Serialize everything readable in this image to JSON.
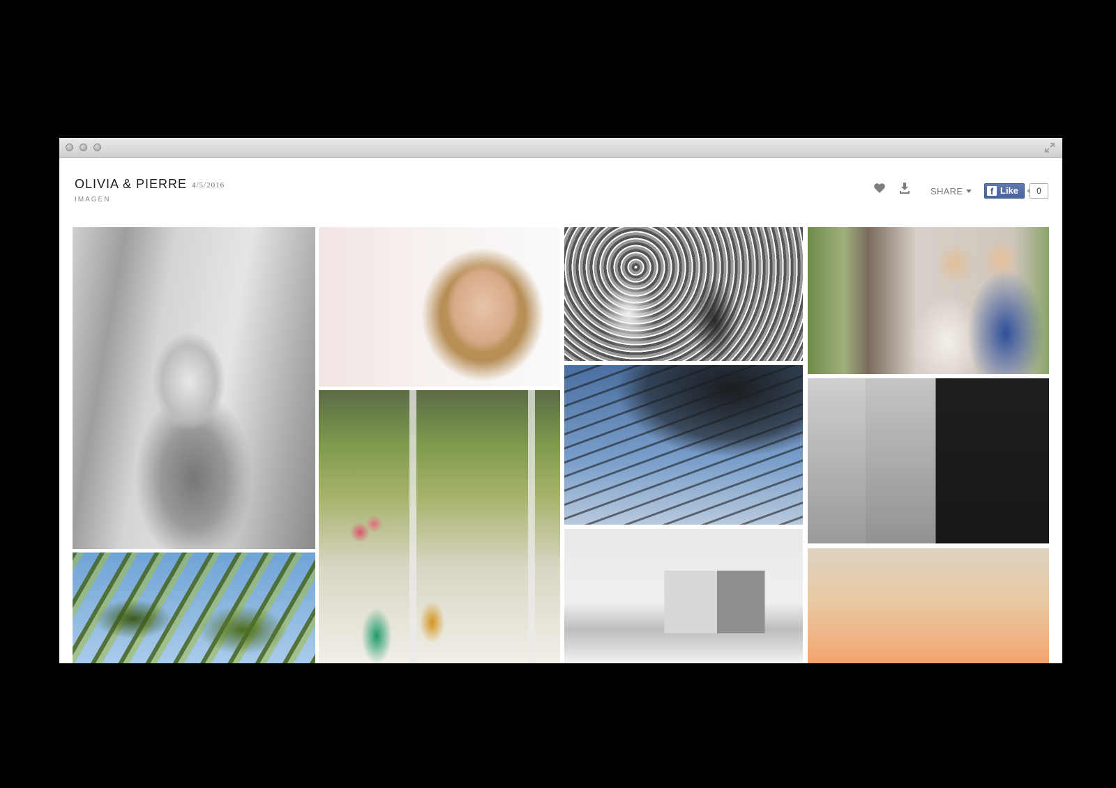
{
  "window": {
    "controls": [
      "close-dot",
      "minimize-dot",
      "zoom-dot"
    ],
    "expand_icon": "expand-icon"
  },
  "gallery": {
    "title": "OLIVIA & PIERRE",
    "date": "4/5/2016",
    "subtitle": "IMAGEN"
  },
  "toolbar": {
    "favorite_icon": "heart-icon",
    "download_icon": "download-icon",
    "share_label": "SHARE",
    "like_label": "Like",
    "like_count": "0"
  },
  "photos": [
    "bride-portrait-bw",
    "bride-smiling-closeup",
    "petal-toss-bw",
    "couple-portrait-color",
    "palm-trees",
    "table-setting-flowers",
    "palm-silhouette-string-lights",
    "couple-holding-hands-bw",
    "church-bw",
    "sunset-sky"
  ]
}
